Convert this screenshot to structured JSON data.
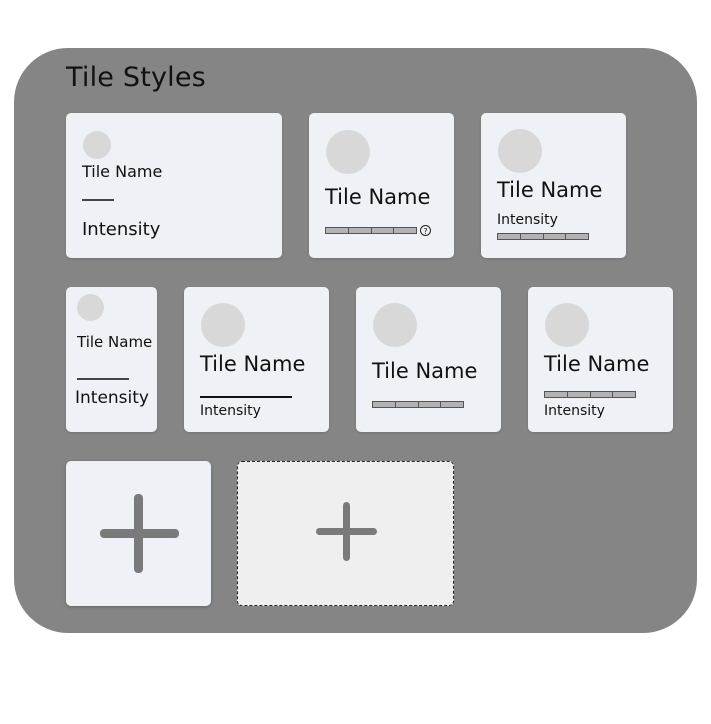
{
  "panel": {
    "title": "Tile Styles"
  },
  "tiles": [
    {
      "name": "Tile Name",
      "intensity": "Intensity"
    },
    {
      "name": "Tile Name",
      "help": "?"
    },
    {
      "name": "Tile Name",
      "intensity": "Intensity"
    },
    {
      "name": "Tile Name",
      "intensity": "Intensity"
    },
    {
      "name": "Tile Name",
      "intensity": "Intensity"
    },
    {
      "name": "Tile Name"
    },
    {
      "name": "Tile Name",
      "intensity": "Intensity"
    }
  ],
  "add_tiles": [
    {
      "icon": "plus-icon"
    },
    {
      "icon": "plus-icon"
    }
  ],
  "colors": {
    "panel_bg": "#858585",
    "tile_bg": "#eef2f7",
    "icon_gray": "#7a7a7a"
  }
}
